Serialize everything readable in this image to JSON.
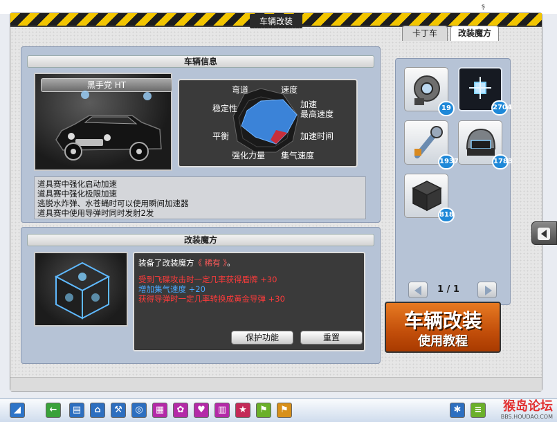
{
  "window": {
    "title": "车辆改装"
  },
  "vehicle_info": {
    "header": "车辆信息",
    "car_name": "黑手党 HT",
    "stats": {
      "labels": [
        "弯道",
        "速度",
        "稳定性",
        "加速",
        "最高速度",
        "平衡",
        "加速时间",
        "强化力量",
        "集气速度"
      ]
    },
    "descriptions": [
      "道具赛中强化启动加速",
      "道具赛中强化极限加速",
      "逃脱水炸弹、水苍蝇时可以使用瞬间加速器",
      "道具赛中使用导弹时同时发射2发"
    ]
  },
  "cube": {
    "header": "改装魔方",
    "equipped_prefix": "装备了改装魔方",
    "equipped_name": "《 稀有 》",
    "equipped_suffix": "。",
    "effects": [
      "受到飞碟攻击时一定几率获得盾牌  +30",
      "增加集气速度  +20",
      "获得导弹时一定几率转换成黄金导弹  +30"
    ],
    "buttons": {
      "protect": "保护功能",
      "reset": "重置"
    }
  },
  "inventory": {
    "tabs": [
      "卡丁车",
      "改装魔方"
    ],
    "active_tab": "改装魔方",
    "items": [
      {
        "icon": "armored-part-icon",
        "count": "19"
      },
      {
        "icon": "blue-crystal-icon",
        "count": "2704"
      },
      {
        "icon": "wrench-icon",
        "count": "1937"
      },
      {
        "icon": "helmet-icon",
        "count": "1783"
      },
      {
        "icon": "black-cube-icon",
        "count": "818"
      }
    ],
    "pagination": {
      "current": "1",
      "separator": "/",
      "total": "1"
    }
  },
  "tutorial": {
    "title": "车辆改装",
    "subtitle": "使用教程"
  },
  "colors": {
    "effect_red": "#ff3b3b",
    "effect_blue": "#4aa8ff",
    "rare": "#ff5a5a",
    "accent_yellow": "#f2c500"
  },
  "watermark": {
    "text": "猴岛论坛",
    "url": "BBS.HOUDAO.COM"
  }
}
